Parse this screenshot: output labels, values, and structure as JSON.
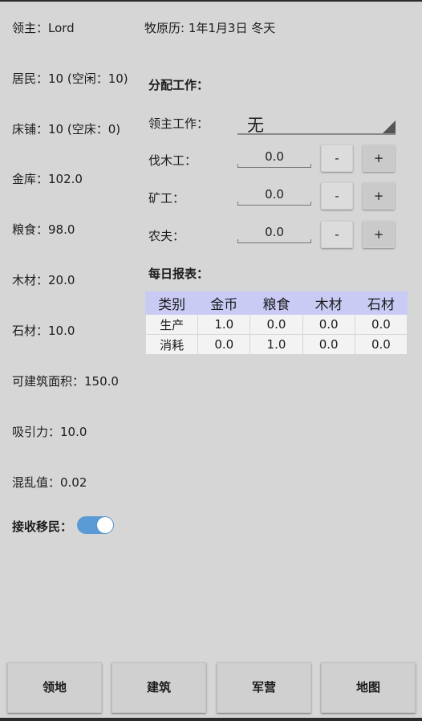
{
  "status": {
    "lord": "领主：Lord",
    "residents": "居民：10 (空闲：10)",
    "beds": "床铺：10 (空床：0)",
    "treasury": "金库：102.0",
    "food": "粮食：98.0",
    "wood": "木材：20.0",
    "stone": "石材：10.0",
    "build_area": "可建筑面积：150.0",
    "attraction": "吸引力：10.0",
    "chaos": "混乱值：0.02",
    "accept_immigrants": "接收移民：",
    "accept_immigrants_on": true
  },
  "calendar": "牧原历: 1年1月3日  冬天",
  "assign": {
    "title": "分配工作：",
    "lord_job_label": "领主工作：",
    "lord_job_value": "无",
    "jobs": [
      {
        "label": "伐木工：",
        "value": "0.0"
      },
      {
        "label": "矿工：",
        "value": "0.0"
      },
      {
        "label": "农夫：",
        "value": "0.0"
      }
    ],
    "minus": "-",
    "plus": "+"
  },
  "report": {
    "title": "每日报表：",
    "headers": [
      "类别",
      "金币",
      "粮食",
      "木材",
      "石材"
    ],
    "rows": [
      [
        "生产",
        "1.0",
        "0.0",
        "0.0",
        "0.0"
      ],
      [
        "消耗",
        "0.0",
        "1.0",
        "0.0",
        "0.0"
      ]
    ]
  },
  "nav": [
    "领地",
    "建筑",
    "军营",
    "地图"
  ],
  "colors": {
    "header_bg": "#c9cbf5",
    "toggle": "#5a9bd5",
    "background": "#d6d6d6"
  }
}
